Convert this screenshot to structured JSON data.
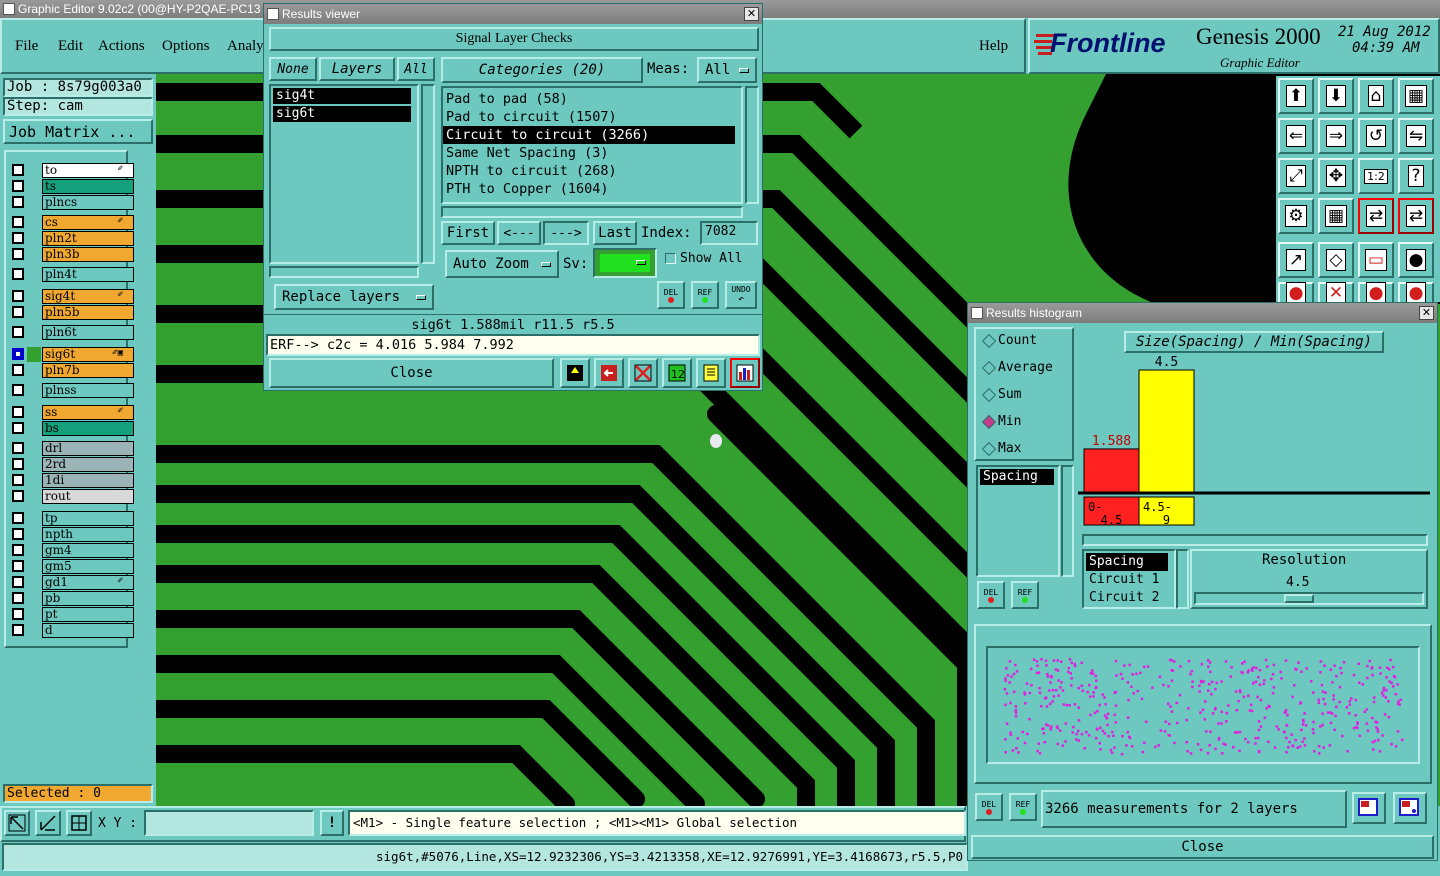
{
  "app": {
    "title": "Graphic Editor 9.02c2 (00@HY-P2QAE-PC13"
  },
  "menu": {
    "file": "File",
    "edit": "Edit",
    "actions": "Actions",
    "options": "Options",
    "analysis": "Analy",
    "help": "Help"
  },
  "brand": {
    "logo": "Frontline",
    "product": "Genesis 2000",
    "subtitle": "Graphic Editor",
    "date": "21 Aug 2012",
    "time": "04:39 AM"
  },
  "job": {
    "job": "Job : 8s79g003a0",
    "step": "Step: cam",
    "matrix": "Job Matrix ..."
  },
  "layers": [
    {
      "name": "to",
      "color": "#ffffff",
      "mark": "✐",
      "checked": false
    },
    {
      "name": "ts",
      "color": "#14a07a",
      "mark": "",
      "checked": false
    },
    {
      "name": "plncs",
      "color": "#6dc8c0",
      "mark": "",
      "checked": false
    },
    {
      "name": "cs",
      "color": "#f0a830",
      "mark": "✐",
      "checked": false
    },
    {
      "name": "pln2t",
      "color": "#f0a830",
      "mark": "",
      "checked": false
    },
    {
      "name": "pln3b",
      "color": "#f0a830",
      "mark": "",
      "checked": false
    },
    {
      "name": "pln4t",
      "color": "#6dc8c0",
      "mark": "",
      "checked": false
    },
    {
      "name": "sig4t",
      "color": "#f0a830",
      "mark": "✐",
      "checked": false
    },
    {
      "name": "pln5b",
      "color": "#f0a830",
      "mark": "",
      "checked": false
    },
    {
      "name": "pln6t",
      "color": "#6dc8c0",
      "mark": "",
      "checked": false
    },
    {
      "name": "sig6t",
      "color": "#f0a830",
      "mark": "✐▣",
      "checked": true
    },
    {
      "name": "pln7b",
      "color": "#f0a830",
      "mark": "",
      "checked": false
    },
    {
      "name": "plnss",
      "color": "#6dc8c0",
      "mark": "",
      "checked": false
    },
    {
      "name": "ss",
      "color": "#f0a830",
      "mark": "✐",
      "checked": false
    },
    {
      "name": "bs",
      "color": "#14a07a",
      "mark": "",
      "checked": false
    },
    {
      "name": "drl",
      "color": "#9ab4b8",
      "mark": "",
      "checked": false
    },
    {
      "name": "2rd",
      "color": "#9ab4b8",
      "mark": "",
      "checked": false
    },
    {
      "name": "1di",
      "color": "#9ab4b8",
      "mark": "",
      "checked": false
    },
    {
      "name": "rout",
      "color": "#d8d8d8",
      "mark": "",
      "checked": false
    },
    {
      "name": "tp",
      "color": "#6dc8c0",
      "mark": "",
      "checked": false
    },
    {
      "name": "npth",
      "color": "#6dc8c0",
      "mark": "",
      "checked": false
    },
    {
      "name": "gm4",
      "color": "#6dc8c0",
      "mark": "",
      "checked": false
    },
    {
      "name": "gm5",
      "color": "#6dc8c0",
      "mark": "",
      "checked": false
    },
    {
      "name": "gd1",
      "color": "#6dc8c0",
      "mark": "✐",
      "checked": false
    },
    {
      "name": "pb",
      "color": "#6dc8c0",
      "mark": "",
      "checked": false
    },
    {
      "name": "pt",
      "color": "#6dc8c0",
      "mark": "",
      "checked": false
    },
    {
      "name": "d",
      "color": "#6dc8c0",
      "mark": "",
      "checked": false
    }
  ],
  "selected": "Selected : 0",
  "bottom": {
    "xy_label": "X Y :",
    "xy_value": "",
    "hint": "<M1> - Single feature selection ; <M1><M1> Global selection",
    "status": "sig6t,#5076,Line,XS=12.9232306,YS=3.4213358,XE=12.9276991,YE=3.4168673,r5.5,P0"
  },
  "results_viewer": {
    "title": "Results viewer",
    "header": "Signal Layer Checks",
    "none_btn": "None",
    "layers_btn": "Layers",
    "all_btn": "All",
    "layer_list": [
      "sig4t",
      "sig6t"
    ],
    "categories_btn": "Categories (20)",
    "meas_label": "Meas:",
    "meas_value": "All",
    "categories": [
      "Pad to pad (58)",
      "Pad to circuit (1507)",
      "Circuit to circuit (3266)",
      "Same Net Spacing (3)",
      "NPTH to circuit (268)",
      "PTH to Copper (1604)"
    ],
    "selected_category": 2,
    "first": "First",
    "prev": "<---",
    "next": "--->",
    "last": "Last",
    "index_label": "Index:",
    "index_value": "7082",
    "auto_zoom": "Auto Zoom",
    "sv_label": "Sv:",
    "show_all": "Show All",
    "replace_layers": "Replace layers",
    "del": "DEL",
    "ref": "REF",
    "undo": "UNDO",
    "info": "sig6t 1.588mil  r11.5  r5.5",
    "erf": "ERF--> c2c = 4.016 5.984 7.992",
    "close": "Close"
  },
  "histogram": {
    "title": "Results histogram",
    "modes": [
      "Count",
      "Average",
      "Sum",
      "Min",
      "Max"
    ],
    "selected_mode": 3,
    "chart_title": "Size(Spacing) / Min(Spacing)",
    "list_item": "Spacing",
    "bins": [
      {
        "label_top": "0-",
        "label_bottom": "4.5",
        "value": 1.588,
        "color": "#ff2020"
      },
      {
        "label_top": "4.5-",
        "label_bottom": "9",
        "value": 4.5,
        "color": "#ffff00"
      }
    ],
    "value_labels": [
      "1.588",
      "4.5"
    ],
    "value_colors": [
      "#c80000",
      "#000000"
    ],
    "y_max": 4.5,
    "fields": [
      "Spacing",
      "Circuit 1",
      "Circuit 2"
    ],
    "resolution_label": "Resolution",
    "resolution_value": "4.5",
    "measurements": "3266 measurements for 2 layers",
    "close": "Close",
    "del": "DEL",
    "ref": "REF"
  }
}
